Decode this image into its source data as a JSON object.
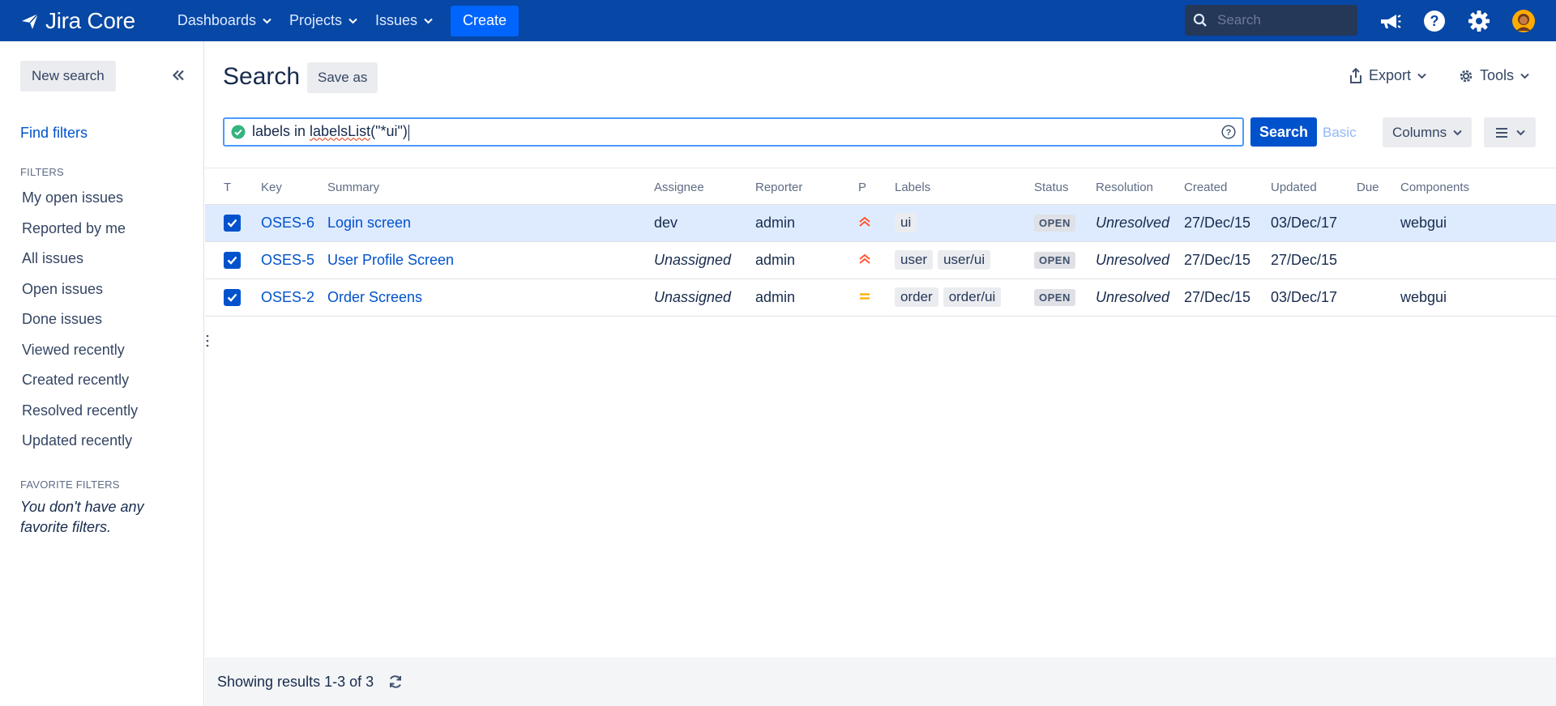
{
  "topnav": {
    "product": "Jira Core",
    "items": [
      {
        "label": "Dashboards"
      },
      {
        "label": "Projects"
      },
      {
        "label": "Issues"
      }
    ],
    "create_label": "Create",
    "search_placeholder": "Search",
    "colors": {
      "bar": "#0747a6",
      "accent": "#0065ff"
    }
  },
  "sidebar": {
    "new_search_label": "New search",
    "find_filters_label": "Find filters",
    "filters_heading": "FILTERS",
    "filters": [
      "My open issues",
      "Reported by me",
      "All issues",
      "Open issues",
      "Done issues",
      "Viewed recently",
      "Created recently",
      "Resolved recently",
      "Updated recently"
    ],
    "favorites_heading": "FAVORITE FILTERS",
    "favorites_empty": "You don't have any favorite filters."
  },
  "main": {
    "title": "Search",
    "save_as_label": "Save as",
    "export_label": "Export",
    "tools_label": "Tools",
    "jql": {
      "prefix": "labels in ",
      "fn": "labelsList",
      "args": "(\"*ui\")"
    },
    "search_label": "Search",
    "basic_label": "Basic",
    "columns_label": "Columns"
  },
  "table": {
    "headers": [
      "T",
      "Key",
      "Summary",
      "Assignee",
      "Reporter",
      "P",
      "Labels",
      "Status",
      "Resolution",
      "Created",
      "Updated",
      "Due",
      "Components"
    ],
    "rows": [
      {
        "key": "OSES-6",
        "summary": "Login screen",
        "assignee": "dev",
        "assignee_italic": false,
        "reporter": "admin",
        "priority": "high",
        "labels": [
          "ui"
        ],
        "status": "OPEN",
        "resolution": "Unresolved",
        "created": "27/Dec/15",
        "updated": "03/Dec/17",
        "due": "",
        "components": "webgui"
      },
      {
        "key": "OSES-5",
        "summary": "User Profile Screen",
        "assignee": "Unassigned",
        "assignee_italic": true,
        "reporter": "admin",
        "priority": "high",
        "labels": [
          "user",
          "user/ui"
        ],
        "status": "OPEN",
        "resolution": "Unresolved",
        "created": "27/Dec/15",
        "updated": "27/Dec/15",
        "due": "",
        "components": ""
      },
      {
        "key": "OSES-2",
        "summary": "Order Screens",
        "assignee": "Unassigned",
        "assignee_italic": true,
        "reporter": "admin",
        "priority": "medium",
        "labels": [
          "order",
          "order/ui"
        ],
        "status": "OPEN",
        "resolution": "Unresolved",
        "created": "27/Dec/15",
        "updated": "03/Dec/17",
        "due": "",
        "components": "webgui"
      }
    ]
  },
  "footer": {
    "results_text": "Showing results 1-3 of 3"
  }
}
